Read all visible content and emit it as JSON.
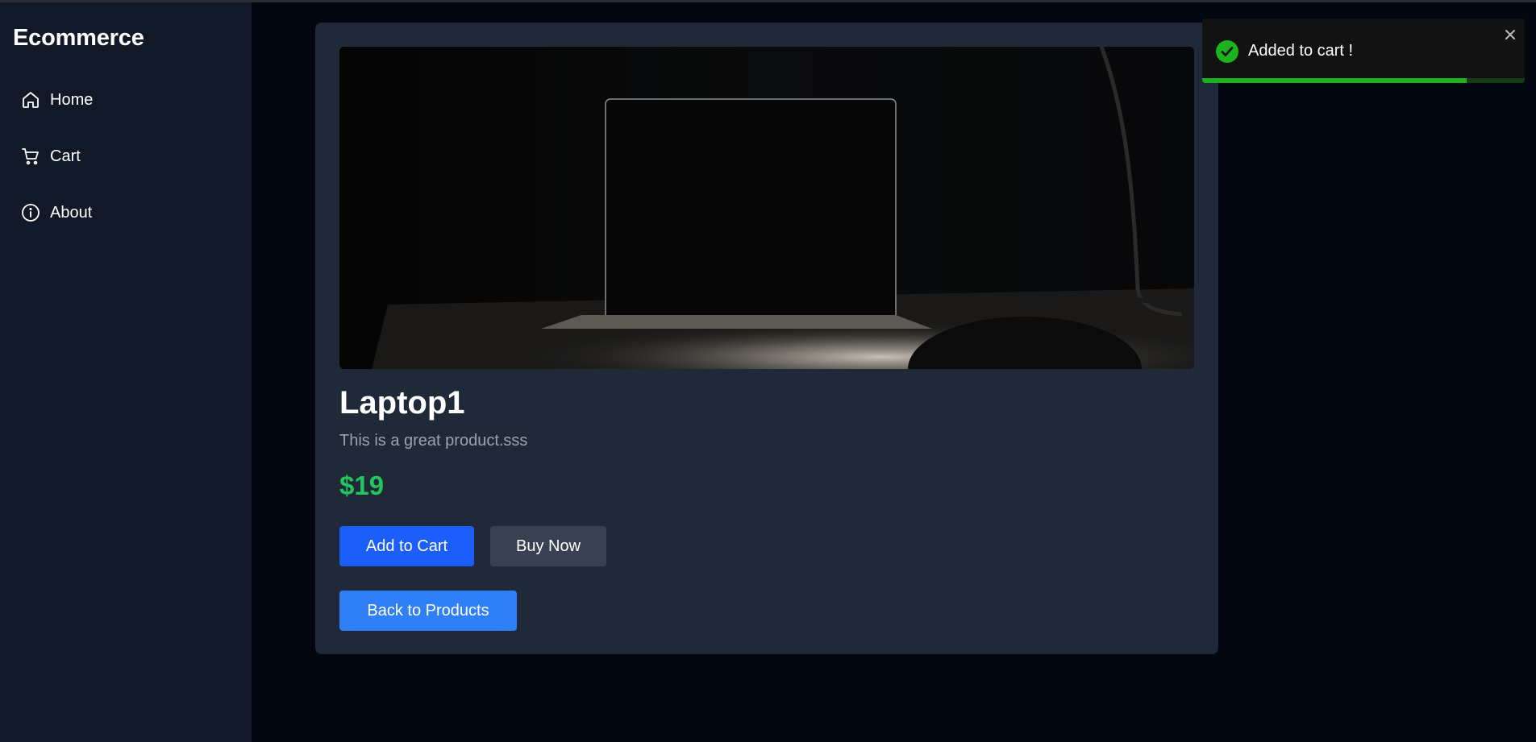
{
  "sidebar": {
    "brand": "Ecommerce",
    "items": [
      {
        "label": "Home",
        "icon": "home-icon"
      },
      {
        "label": "Cart",
        "icon": "cart-icon"
      },
      {
        "label": "About",
        "icon": "info-icon"
      }
    ]
  },
  "product": {
    "image": "laptop-on-desk-dark-photo",
    "title": "Laptop1",
    "description": "This is a great product.sss",
    "price": "$19",
    "add_to_cart_label": "Add to Cart",
    "buy_now_label": "Buy Now",
    "back_label": "Back to Products"
  },
  "toast": {
    "message": "Added to cart !",
    "icon": "check-circle-icon",
    "close_icon": "close-icon",
    "progress": 0.82
  },
  "colors": {
    "sidebar_bg": "#111827",
    "page_bg": "#030712",
    "card_bg": "#1f2937",
    "price": "#22c55e",
    "primary_button": "#1c5ef9",
    "secondary_button": "#374151",
    "back_button": "#2f80f7",
    "toast_success": "#1db31d"
  }
}
